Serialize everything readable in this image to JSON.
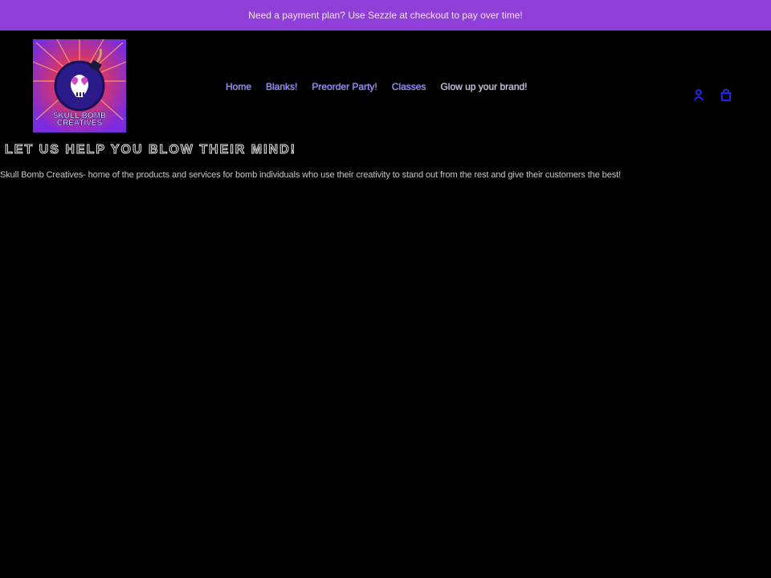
{
  "announcement": {
    "text": "Need a payment plan? Use Sezzle at checkout to pay over time!"
  },
  "logo": {
    "line1": "SKULL BOMB",
    "line2": "CREATIVES"
  },
  "nav": {
    "items": [
      {
        "label": "Home"
      },
      {
        "label": "Blanks!"
      },
      {
        "label": "Preorder Party!"
      },
      {
        "label": "Classes"
      },
      {
        "label": "Glow up your brand!"
      }
    ]
  },
  "header_icons": {
    "account": "account-icon",
    "cart": "cart-icon"
  },
  "hero": {
    "title": "LET US HELP YOU BLOW THEIR MIND!",
    "text": "Skull Bomb Creatives- home of the products and services for bomb individuals who use their creativity to stand out from the rest and give their customers the best!"
  },
  "colors": {
    "accent": "#8f3fd8",
    "background": "#000000",
    "nav_link": "#8a8aff"
  }
}
